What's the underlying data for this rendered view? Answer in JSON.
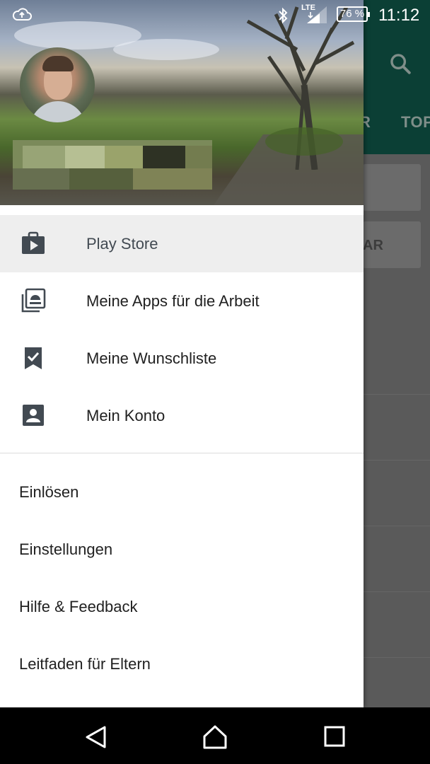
{
  "status_bar": {
    "network": "LTE",
    "battery": "76 %",
    "time": "11:12",
    "icons": [
      "cloud-upload-icon",
      "bluetooth-icon",
      "signal-icon",
      "battery-icon"
    ]
  },
  "background_app": {
    "tab_partial_1": "R",
    "tab_partial_2": "TOP",
    "card_label_partial": "AR",
    "toolbar_color": "#0b3f35"
  },
  "drawer": {
    "primary_items": [
      {
        "label": "Play Store",
        "icon": "shop-bag-icon",
        "selected": true
      },
      {
        "label": "Meine Apps für die Arbeit",
        "icon": "work-apps-icon",
        "selected": false
      },
      {
        "label": "Meine Wunschliste",
        "icon": "wishlist-icon",
        "selected": false
      },
      {
        "label": "Mein Konto",
        "icon": "account-icon",
        "selected": false
      }
    ],
    "secondary_items": [
      {
        "label": "Einlösen"
      },
      {
        "label": "Einstellungen"
      },
      {
        "label": "Hilfe & Feedback"
      },
      {
        "label": "Leitfaden für Eltern"
      }
    ]
  },
  "colors": {
    "accent_dark": "#0b3f35",
    "icon": "#424a52",
    "selected_bg": "#eeeeee"
  }
}
